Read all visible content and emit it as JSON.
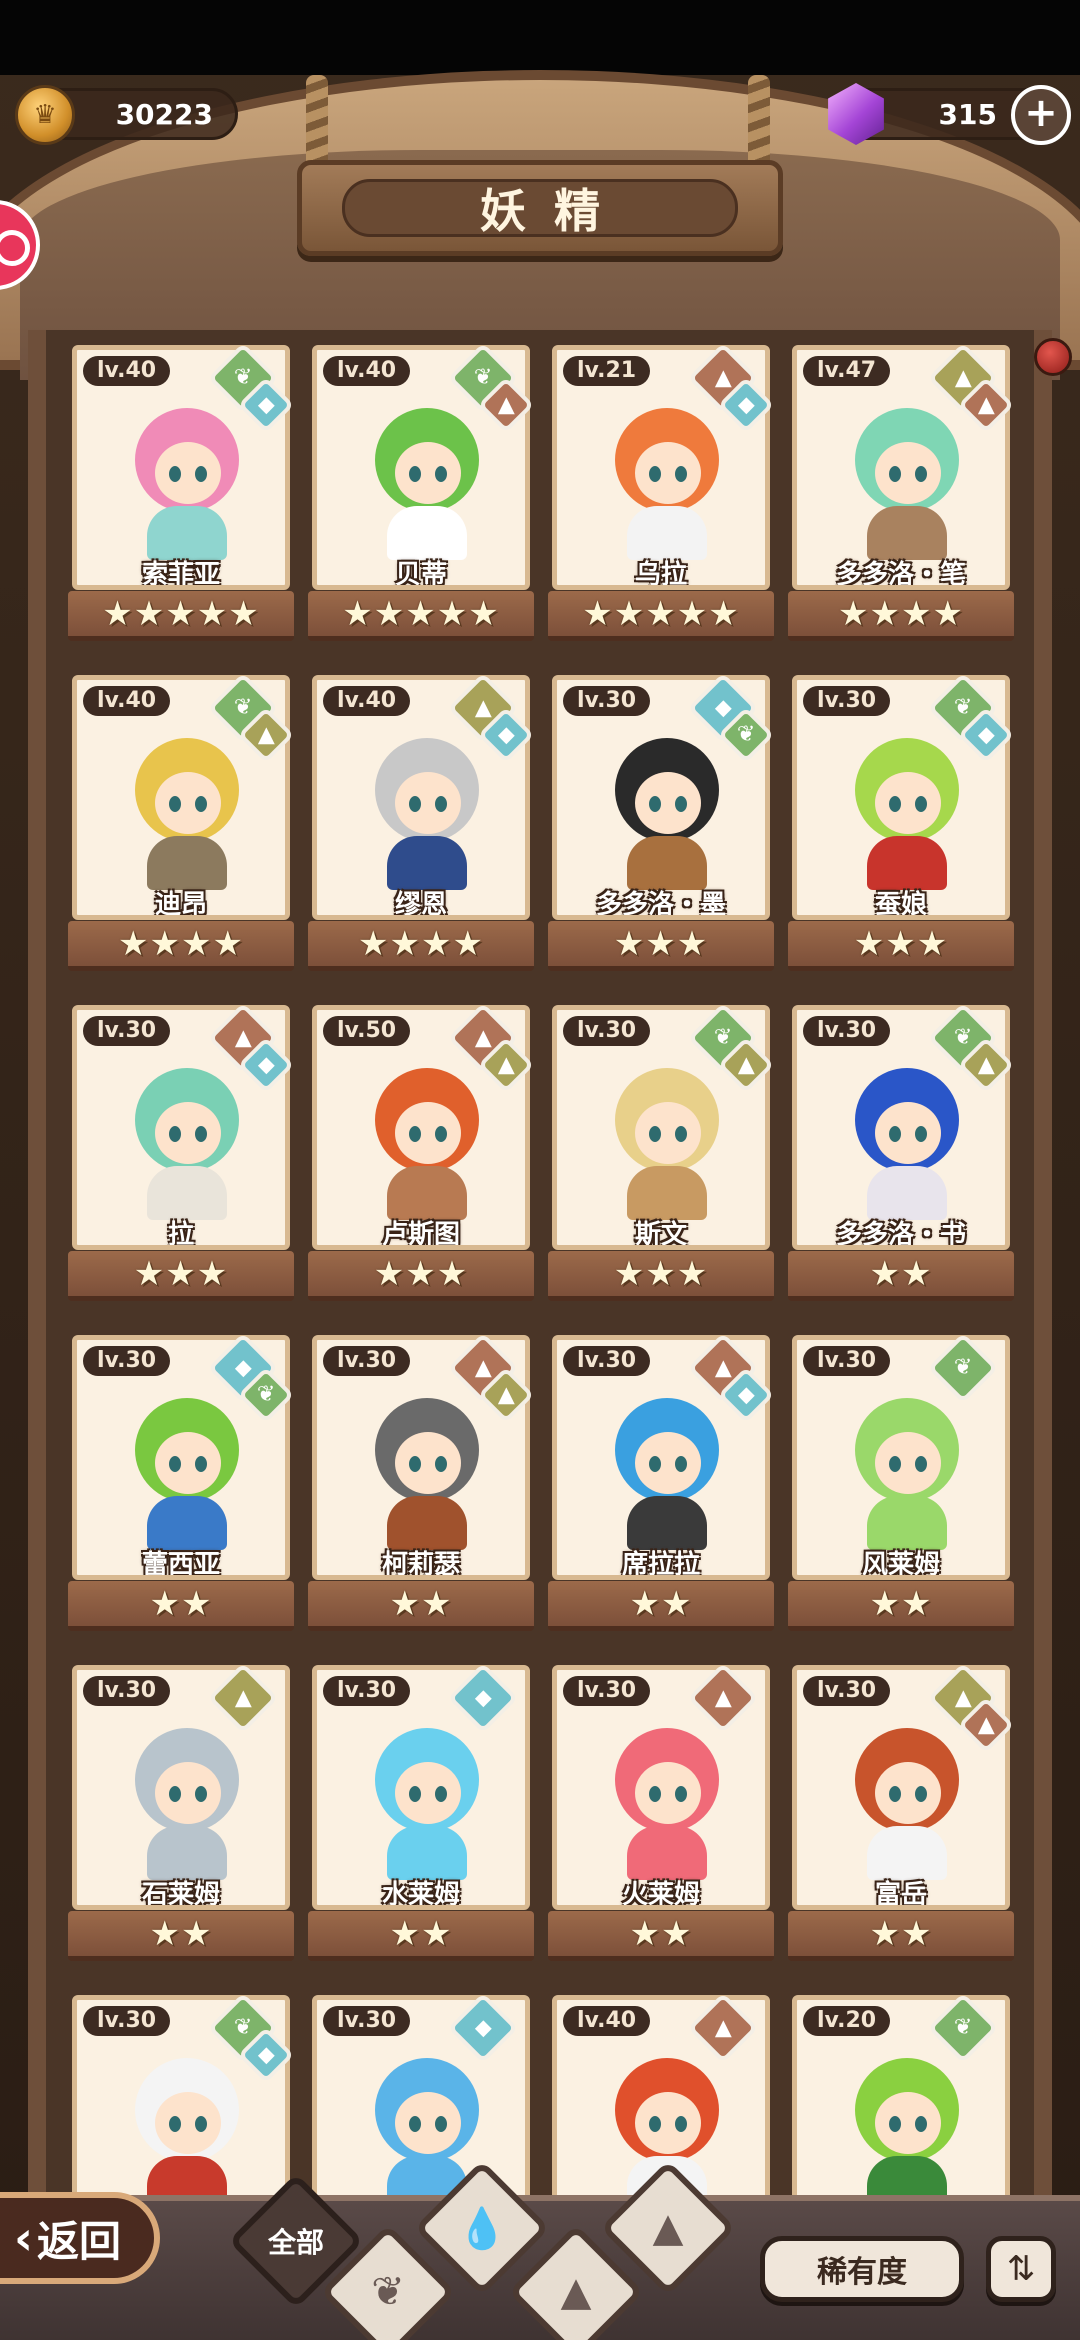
{
  "header": {
    "title": "妖精",
    "gold": "30223",
    "gems": "315",
    "plus": "+"
  },
  "cards": [
    {
      "level": "lv.40",
      "name": "索菲亚",
      "stars": "★★★★★",
      "elements": [
        "grass",
        "water"
      ],
      "hair": "#f08bb7",
      "outfit": "#8fd5cf"
    },
    {
      "level": "lv.40",
      "name": "贝蒂",
      "stars": "★★★★★",
      "elements": [
        "grass",
        "fire"
      ],
      "hair": "#6cc24a",
      "outfit": "#ffffff"
    },
    {
      "level": "lv.21",
      "name": "乌拉",
      "stars": "★★★★★",
      "elements": [
        "fire",
        "water"
      ],
      "hair": "#ef7a3c",
      "outfit": "#f3f3f3"
    },
    {
      "level": "lv.47",
      "name": "多多洛・笔",
      "stars": "★★★★",
      "elements": [
        "earth",
        "fire"
      ],
      "hair": "#7fd6b4",
      "outfit": "#a9825f"
    },
    {
      "level": "lv.40",
      "name": "迪昂",
      "stars": "★★★★",
      "elements": [
        "grass",
        "earth"
      ],
      "hair": "#e8c44c",
      "outfit": "#8c7a5e"
    },
    {
      "level": "lv.40",
      "name": "缪恩",
      "stars": "★★★★",
      "elements": [
        "earth",
        "water"
      ],
      "hair": "#c8c8c8",
      "outfit": "#2f4c8c"
    },
    {
      "level": "lv.30",
      "name": "多多洛・墨",
      "stars": "★★★",
      "elements": [
        "water",
        "grass"
      ],
      "hair": "#2a2a2a",
      "outfit": "#a8703e"
    },
    {
      "level": "lv.30",
      "name": "蚕娘",
      "stars": "★★★",
      "elements": [
        "grass",
        "water"
      ],
      "hair": "#a6d84c",
      "outfit": "#c8342c"
    },
    {
      "level": "lv.30",
      "name": "拉",
      "stars": "★★★",
      "elements": [
        "fire",
        "water"
      ],
      "hair": "#7ad0b4",
      "outfit": "#e9e4da"
    },
    {
      "level": "lv.50",
      "name": "卢斯图",
      "stars": "★★★",
      "elements": [
        "fire",
        "earth"
      ],
      "hair": "#e0602c",
      "outfit": "#b87a52"
    },
    {
      "level": "lv.30",
      "name": "斯文",
      "stars": "★★★",
      "elements": [
        "grass",
        "earth"
      ],
      "hair": "#e8d08a",
      "outfit": "#c89a62"
    },
    {
      "level": "lv.30",
      "name": "多多洛・书",
      "stars": "★★",
      "elements": [
        "grass",
        "earth"
      ],
      "hair": "#2a56c8",
      "outfit": "#e8e4ec"
    },
    {
      "level": "lv.30",
      "name": "蕾西亚",
      "stars": "★★",
      "elements": [
        "water",
        "grass"
      ],
      "hair": "#7ac840",
      "outfit": "#3a7ac8"
    },
    {
      "level": "lv.30",
      "name": "柯莉瑟",
      "stars": "★★",
      "elements": [
        "fire",
        "earth"
      ],
      "hair": "#6a6a6a",
      "outfit": "#a0522d"
    },
    {
      "level": "lv.30",
      "name": "席拉拉",
      "stars": "★★",
      "elements": [
        "fire",
        "water"
      ],
      "hair": "#3aa0e0",
      "outfit": "#3a3a3a"
    },
    {
      "level": "lv.30",
      "name": "风莱姆",
      "stars": "★★",
      "elements": [
        "grass"
      ],
      "hair": "#9ad86a",
      "outfit": "#9ad86a"
    },
    {
      "level": "lv.30",
      "name": "石莱姆",
      "stars": "★★",
      "elements": [
        "earth"
      ],
      "hair": "#b8c4cc",
      "outfit": "#b8c4cc"
    },
    {
      "level": "lv.30",
      "name": "水莱姆",
      "stars": "★★",
      "elements": [
        "water"
      ],
      "hair": "#6ad0ee",
      "outfit": "#6ad0ee"
    },
    {
      "level": "lv.30",
      "name": "火莱姆",
      "stars": "★★",
      "elements": [
        "fire"
      ],
      "hair": "#f06a78",
      "outfit": "#f06a78"
    },
    {
      "level": "lv.30",
      "name": "富岳",
      "stars": "★★",
      "elements": [
        "earth",
        "fire"
      ],
      "hair": "#c8542c",
      "outfit": "#f4f4f4"
    },
    {
      "level": "lv.30",
      "name": "",
      "stars": "",
      "elements": [
        "grass",
        "water"
      ],
      "hair": "#f4f4f4",
      "outfit": "#c83a2c"
    },
    {
      "level": "lv.30",
      "name": "",
      "stars": "",
      "elements": [
        "water"
      ],
      "hair": "#5ab4e8",
      "outfit": "#5ab4e8"
    },
    {
      "level": "lv.40",
      "name": "",
      "stars": "",
      "elements": [
        "fire"
      ],
      "hair": "#e0502c",
      "outfit": "#f4f4f4"
    },
    {
      "level": "lv.20",
      "name": "",
      "stars": "",
      "elements": [
        "grass"
      ],
      "hair": "#8ad040",
      "outfit": "#3a8a3a"
    }
  ],
  "bottom": {
    "back": "返回",
    "filter_all": "全部",
    "rarity": "稀有度",
    "sort_icon": "sort-icon"
  },
  "colors": {
    "grass": "#7eb46a",
    "water": "#72c2cc",
    "fire": "#b07358",
    "earth": "#a8a259"
  }
}
